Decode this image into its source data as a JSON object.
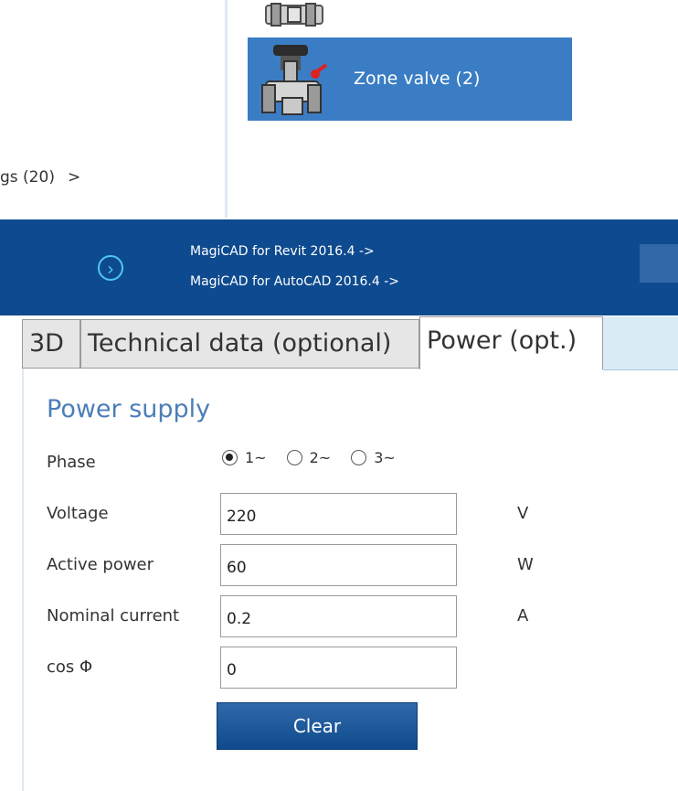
{
  "browser": {
    "tile_label": "Zone valve (2)",
    "category_label": "gs (20)",
    "category_arrow": ">"
  },
  "banner": {
    "link_revit": "MagiCAD for Revit 2016.4 ->",
    "link_autocad": "MagiCAD for AutoCAD 2016.4 ->",
    "circle_arrow": "›"
  },
  "tabs": [
    {
      "label": "3D",
      "active": false
    },
    {
      "label": "Technical data (optional)",
      "active": false
    },
    {
      "label": "Power (opt.)",
      "active": true
    }
  ],
  "power": {
    "section_title": "Power supply",
    "phase_label": "Phase",
    "phase_options": [
      "1~",
      "2~",
      "3~"
    ],
    "phase_selected": "1~",
    "voltage_label": "Voltage",
    "voltage_value": "220",
    "voltage_unit": "V",
    "active_power_label": "Active power",
    "active_power_value": "60",
    "active_power_unit": "W",
    "nominal_current_label": "Nominal current",
    "nominal_current_value": "0.2",
    "nominal_current_unit": "A",
    "cos_label": "cos Φ",
    "cos_value": "0",
    "clear_label": "Clear"
  },
  "colors": {
    "banner": "#0e4a8f",
    "tile": "#3b7dc4",
    "accent_text": "#4a7eb8",
    "circle_icon": "#4fc6f3"
  }
}
